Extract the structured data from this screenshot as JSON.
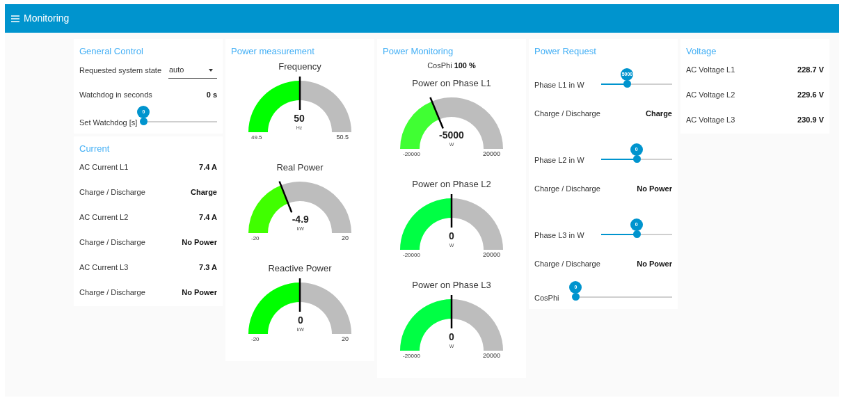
{
  "app_bar": {
    "title": "Monitoring"
  },
  "columns": [
    {
      "groups": [
        {
          "title": "General Control",
          "items": [
            {
              "kind": "select",
              "label": "Requested system state",
              "value": "auto"
            },
            {
              "kind": "text",
              "label": "Watchdog in seconds",
              "value": "0 s"
            },
            {
              "kind": "slider",
              "label": "Set Watchdog [s]",
              "thumb_label": "0",
              "level": 0
            }
          ]
        },
        {
          "title": "Current",
          "items": [
            {
              "kind": "text",
              "label": "AC Current L1",
              "value": "7.4 A"
            },
            {
              "kind": "text",
              "label": "Charge / Discharge",
              "value": "Charge"
            },
            {
              "kind": "text",
              "label": "AC Current L2",
              "value": "7.4 A"
            },
            {
              "kind": "text",
              "label": "Charge / Discharge",
              "value": "No Power"
            },
            {
              "kind": "text",
              "label": "AC Current L3",
              "value": "7.3 A"
            },
            {
              "kind": "text",
              "label": "Charge / Discharge",
              "value": "No Power"
            }
          ]
        }
      ]
    },
    {
      "groups": [
        {
          "title": "Power measurement",
          "items": [
            {
              "kind": "gauge",
              "title": "Frequency",
              "value": "50",
              "unit": "Hz",
              "min": "49.5",
              "max": "50.5",
              "level": 0.5,
              "color": "#00ff00"
            },
            {
              "kind": "gauge",
              "title": "Real Power",
              "value": "-4.9",
              "unit": "kW",
              "min": "-20",
              "max": "20",
              "level": 0.38,
              "color": "#40ff00"
            },
            {
              "kind": "gauge",
              "title": "Reactive Power",
              "value": "0",
              "unit": "kW",
              "min": "-20",
              "max": "20",
              "level": 0.5,
              "color": "#00ff00"
            }
          ]
        }
      ]
    },
    {
      "groups": [
        {
          "title": "Power Monitoring",
          "items": [
            {
              "kind": "caption",
              "label": "CosPhi",
              "value": "100 %"
            },
            {
              "kind": "gauge",
              "title": "Power on Phase L1",
              "value": "-5000",
              "unit": "W",
              "min": "-20000",
              "max": "20000",
              "level": 0.375,
              "color": "#40ff33"
            },
            {
              "kind": "gauge",
              "title": "Power on Phase L2",
              "value": "0",
              "unit": "W",
              "min": "-20000",
              "max": "20000",
              "level": 0.5,
              "color": "#00ff44"
            },
            {
              "kind": "gauge",
              "title": "Power on Phase L3",
              "value": "0",
              "unit": "W",
              "min": "-20000",
              "max": "20000",
              "level": 0.5,
              "color": "#00ff44"
            }
          ]
        }
      ]
    },
    {
      "groups": [
        {
          "title": "Power Request",
          "items": [
            {
              "kind": "slider",
              "label": "Phase L1 in W",
              "thumb_label": "5000",
              "level": 0.37
            },
            {
              "kind": "text",
              "label": "Charge / Discharge",
              "value": "Charge"
            },
            {
              "kind": "slider",
              "label": "Phase L2 in W",
              "thumb_label": "0",
              "level": 0.5
            },
            {
              "kind": "text",
              "label": "Charge / Discharge",
              "value": "No Power"
            },
            {
              "kind": "slider",
              "label": "Phase L3 in W",
              "thumb_label": "0",
              "level": 0.5
            },
            {
              "kind": "text",
              "label": "Charge / Discharge",
              "value": "No Power"
            },
            {
              "kind": "slider",
              "label": "CosPhi",
              "thumb_label": "0",
              "level": 0
            }
          ]
        }
      ]
    },
    {
      "groups": [
        {
          "title": "Voltage",
          "items": [
            {
              "kind": "text",
              "label": "AC Voltage L1",
              "value": "228.7 V"
            },
            {
              "kind": "text",
              "label": "AC Voltage L2",
              "value": "229.6 V"
            },
            {
              "kind": "text",
              "label": "AC Voltage L3",
              "value": "230.9 V"
            }
          ]
        }
      ]
    }
  ]
}
